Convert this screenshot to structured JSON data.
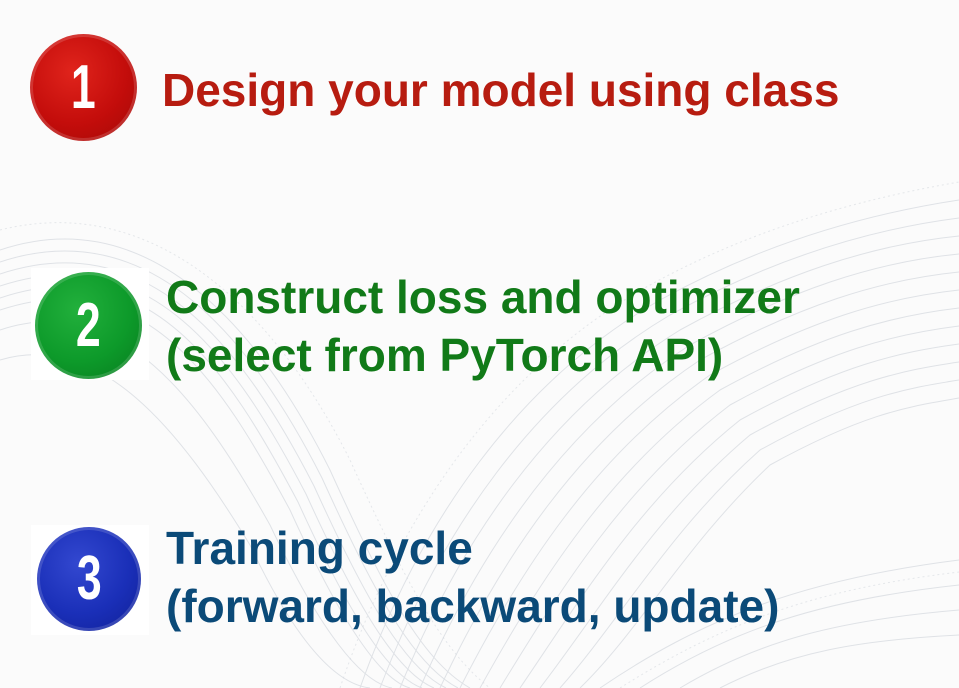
{
  "steps": [
    {
      "number": "1",
      "lines": [
        "Design your model using class"
      ],
      "badge_color": "#c40d0b",
      "text_color": "#b71c10"
    },
    {
      "number": "2",
      "lines": [
        "Construct loss and optimizer",
        "(select from PyTorch API)"
      ],
      "badge_color": "#0d9a2a",
      "text_color": "#117a18"
    },
    {
      "number": "3",
      "lines": [
        "Training cycle",
        "(forward, backward, update)"
      ],
      "badge_color": "#1a2fb8",
      "text_color": "#0b4a78"
    }
  ],
  "background": {
    "color": "#fbfbfb",
    "decoration": "wave-lines"
  }
}
